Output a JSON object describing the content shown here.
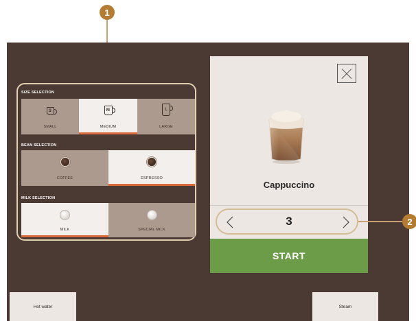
{
  "callouts": {
    "one": "1",
    "two": "2"
  },
  "size_section": {
    "title": "SIZE SELECTION",
    "options": [
      {
        "label": "SMALL",
        "icon_letter": "S"
      },
      {
        "label": "MEDIUM",
        "icon_letter": "M",
        "selected": true
      },
      {
        "label": "LARGE",
        "icon_letter": "L"
      }
    ]
  },
  "bean_section": {
    "title": "BEAN SELECTION",
    "options": [
      {
        "label": "COFFEE"
      },
      {
        "label": "ESPRESSO",
        "selected": true
      }
    ]
  },
  "milk_section": {
    "title": "MILK SELECTION",
    "options": [
      {
        "label": "MILK",
        "selected": true
      },
      {
        "label": "SPECIAL MILK"
      }
    ]
  },
  "product": {
    "name": "Cappuccino"
  },
  "quantity": {
    "value": "3"
  },
  "start_button": {
    "label": "START"
  },
  "bottom_buttons": {
    "hot_water": "Hot water",
    "steam": "Steam"
  },
  "colors": {
    "background": "#4a3a33",
    "panel": "#ece7e3",
    "accent_underline": "#d9683a",
    "start_green": "#6c9c47",
    "callout": "#b47c33",
    "highlight_outline": "#e2cfb0"
  },
  "icons": [
    "close-icon",
    "chevron-left-icon",
    "chevron-right-icon",
    "cup-icon",
    "coffee-bean-icon",
    "milk-icon",
    "cappuccino-image"
  ]
}
